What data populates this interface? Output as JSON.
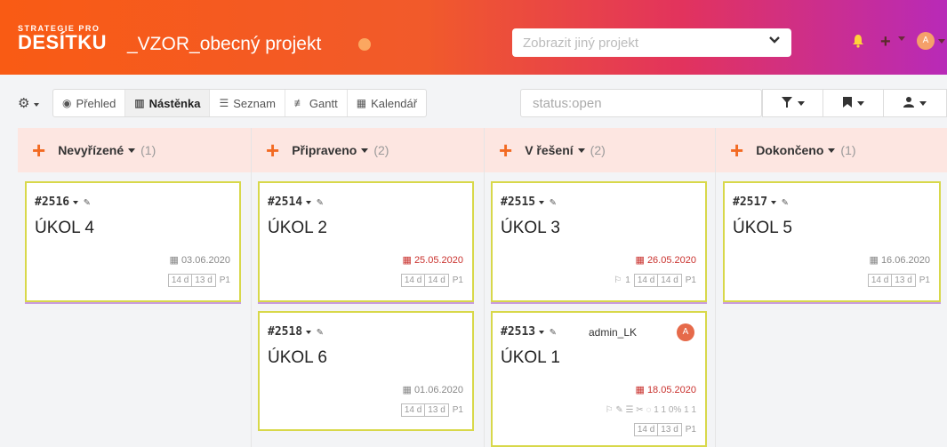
{
  "header": {
    "logo_small": "STRATEGIE PRO",
    "logo_big": "DESÍTKU",
    "project_title": "_VZOR_obecný projekt",
    "project_select_placeholder": "Zobrazit jiný projekt",
    "user_initial": "A"
  },
  "toolbar": {
    "views": [
      {
        "label": "Přehled",
        "icon": "eye-icon"
      },
      {
        "label": "Nástěnka",
        "icon": "board-icon"
      },
      {
        "label": "Seznam",
        "icon": "list-icon"
      },
      {
        "label": "Gantt",
        "icon": "gantt-icon"
      },
      {
        "label": "Kalendář",
        "icon": "calendar-icon"
      }
    ],
    "active_view": "Nástěnka",
    "search_value": "status:open"
  },
  "columns": [
    {
      "name": "Nevyřízené",
      "count": "(1)"
    },
    {
      "name": "Připraveno",
      "count": "(2)"
    },
    {
      "name": "V řešení",
      "count": "(2)"
    },
    {
      "name": "Dokončeno",
      "count": "(1)"
    }
  ],
  "cards": {
    "c2516": {
      "id": "#2516",
      "title": "ÚKOL 4",
      "date": "03.06.2020",
      "est1": "14 d",
      "est2": "13 d",
      "priority": "P1"
    },
    "c2514": {
      "id": "#2514",
      "title": "ÚKOL 2",
      "date": "25.05.2020",
      "est1": "14 d",
      "est2": "14 d",
      "priority": "P1"
    },
    "c2518": {
      "id": "#2518",
      "title": "ÚKOL 6",
      "date": "01.06.2020",
      "est1": "14 d",
      "est2": "13 d",
      "priority": "P1"
    },
    "c2515": {
      "id": "#2515",
      "title": "ÚKOL 3",
      "date": "26.05.2020",
      "flag": "1",
      "est1": "14 d",
      "est2": "14 d",
      "priority": "P1"
    },
    "c2513": {
      "id": "#2513",
      "title": "ÚKOL 1",
      "assignee": "admin_LK",
      "assignee_initial": "A",
      "date": "18.05.2020",
      "meta": "1 1 0% 1 1",
      "est1": "14 d",
      "est2": "13 d",
      "priority": "P1"
    },
    "c2517": {
      "id": "#2517",
      "title": "ÚKOL 5",
      "date": "16.06.2020",
      "est1": "14 d",
      "est2": "13 d",
      "priority": "P1"
    }
  }
}
